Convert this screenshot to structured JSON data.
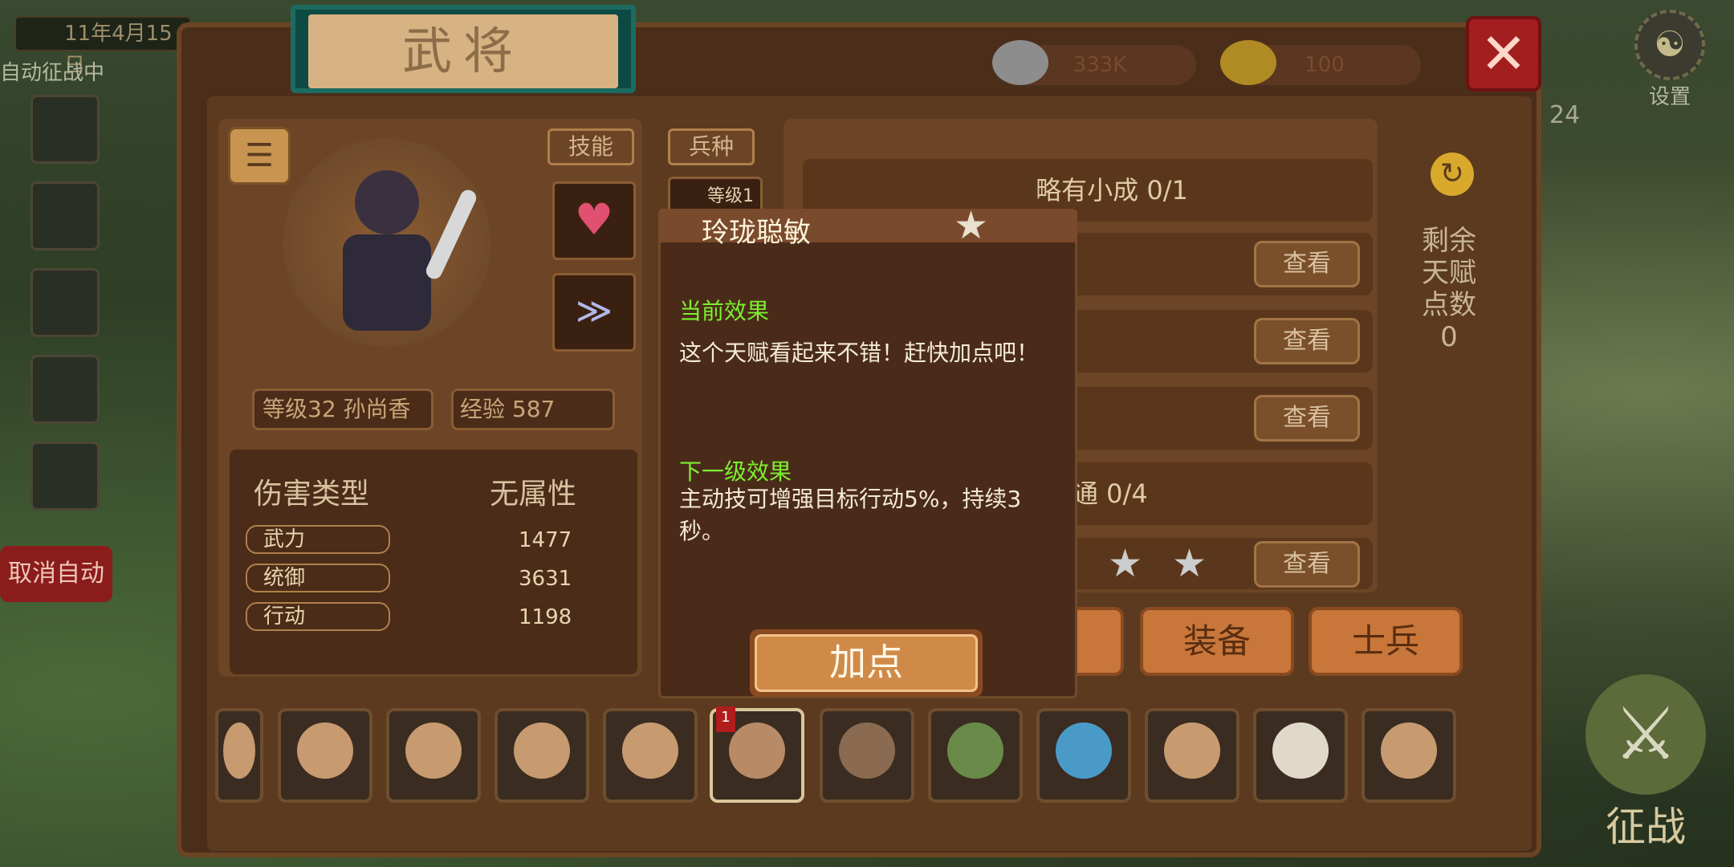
{
  "date": "11年4月15日",
  "auto_label": "自动征战中",
  "cancel_auto": "取消自动",
  "title": "武将",
  "resources": {
    "silver": "333K",
    "gold": "100"
  },
  "settings_label": "设置",
  "side_count": "24",
  "hero": {
    "level_name": "等级32  孙尚香",
    "exp": "经验 587"
  },
  "skill_tab": "技能",
  "troop_tab": "兵种",
  "troop_level": "等级1",
  "stats": {
    "header_label": "伤害类型",
    "header_value": "无属性",
    "rows": [
      {
        "label": "武力",
        "value": "1477"
      },
      {
        "label": "统御",
        "value": "3631"
      },
      {
        "label": "行动",
        "value": "1198"
      }
    ]
  },
  "talents": {
    "first": "略有小成 0/1",
    "fourth": "通 0/4",
    "look": "查看"
  },
  "remaining_label": "剩余天赋点数",
  "remaining_value": "0",
  "tabs": {
    "equip": "装备",
    "soldier": "士兵"
  },
  "popup": {
    "title": "玲珑聪敏",
    "current_label": "当前效果",
    "current_text": "这个天赋看起来不错！赶快加点吧！",
    "next_label": "下一级效果",
    "next_text": "主动技可增强目标行动5%，持续3秒。",
    "button": "加点"
  },
  "selected_badge": "1",
  "war_label": "征战"
}
